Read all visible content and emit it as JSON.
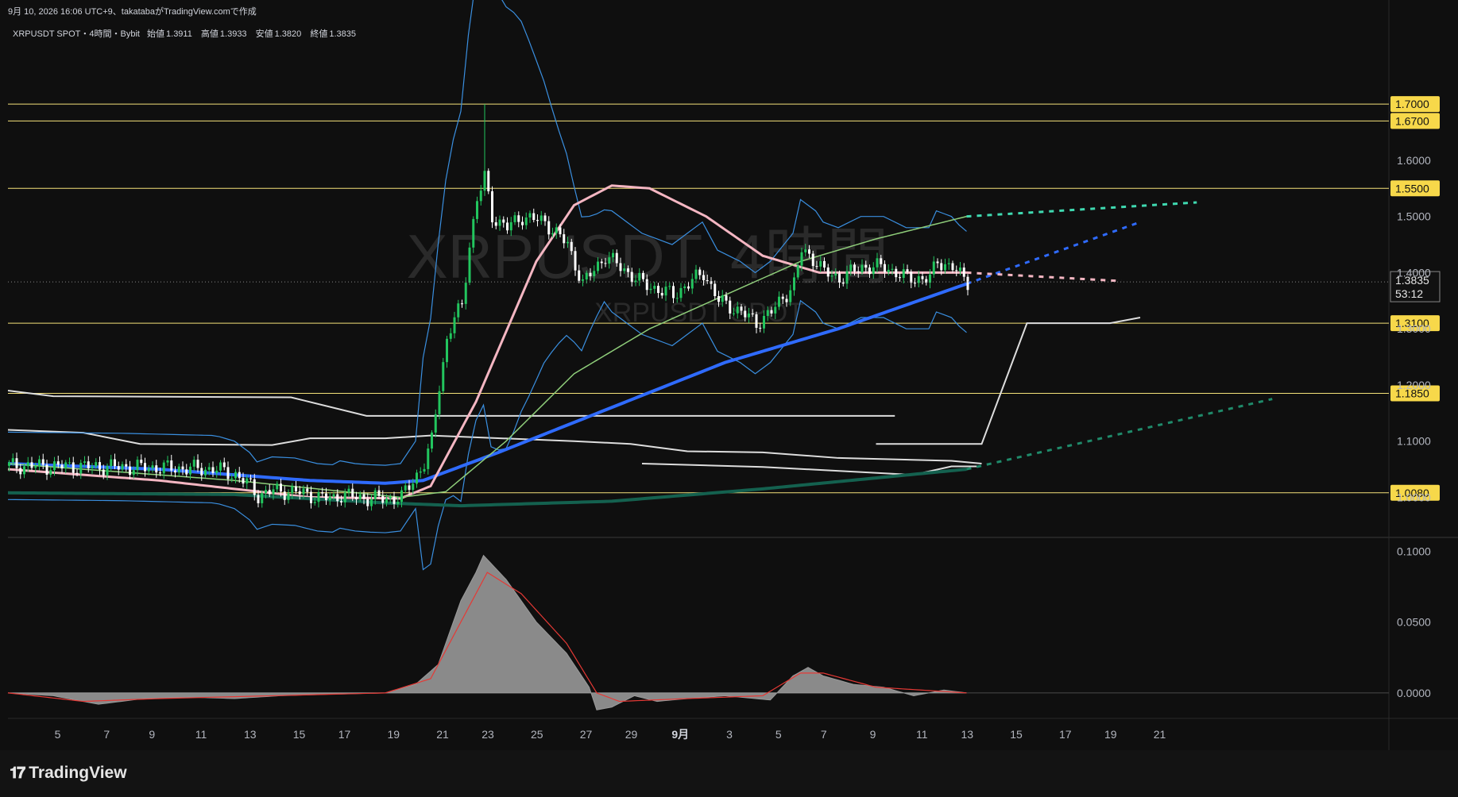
{
  "header": {
    "caption": "9月 10, 2026 16:06 UTC+9、takatabaがTradingView.comで作成"
  },
  "symbol": {
    "title": "XRPUSDT SPOT・4時間・Bybit",
    "open_label": "始値",
    "open": "1.3911",
    "high_label": "高値",
    "high": "1.3933",
    "low_label": "安値",
    "low": "1.3820",
    "close_label": "終値",
    "close": "1.3835"
  },
  "watermark": {
    "line1": "XRPUSDT, 4時間",
    "line2": "XRPUSDT SPOT"
  },
  "footer": {
    "brand": "TradingView"
  },
  "colors": {
    "background": "#0f0f0f",
    "grid": "#1f1f1f",
    "up": "#22c55e",
    "down": "#ffffff",
    "ma_blue": "#2f6bff",
    "ma_pink": "#f4b6c2",
    "ma_teal": "#14614f",
    "ma_green": "#8fce7a",
    "bollinger": "#3a8fe0",
    "level": "#f5e27a",
    "hist": "#8a8a8a",
    "signal": "#e53935"
  },
  "chart_data": [
    {
      "type": "candlestick",
      "title": "XRPUSDT SPOT 4時間 Bybit",
      "x_tick_labels": [
        "5",
        "7",
        "9",
        "11",
        "13",
        "15",
        "17",
        "19",
        "21",
        "23",
        "25",
        "27",
        "29",
        "9月",
        "3",
        "5",
        "7",
        "9",
        "11",
        "13",
        "15",
        "17",
        "19",
        "21"
      ],
      "y_tick_labels": [
        "1.6000",
        "1.5000",
        "1.4000",
        "1.3000",
        "1.2000",
        "1.1000",
        "1.0000"
      ],
      "ylim": [
        0.93,
        1.85
      ],
      "current_price": "1.3835",
      "countdown": "53:12",
      "horizontal_levels": [
        {
          "value": 1.7,
          "label": "1.7000"
        },
        {
          "value": 1.67,
          "label": "1.6700"
        },
        {
          "value": 1.55,
          "label": "1.5500"
        },
        {
          "value": 1.31,
          "label": "1.3100"
        },
        {
          "value": 1.185,
          "label": "1.1850"
        },
        {
          "value": 1.008,
          "label": "1.0080"
        }
      ],
      "price_path": [
        [
          0,
          1.056
        ],
        [
          30,
          1.054
        ],
        [
          55,
          1.05
        ],
        [
          60,
          1.04
        ],
        [
          64,
          1.02
        ],
        [
          66,
          1.003
        ],
        [
          70,
          1.012
        ],
        [
          76,
          1.01
        ],
        [
          82,
          1.0
        ],
        [
          86,
          0.998
        ],
        [
          88,
          1.005
        ],
        [
          92,
          1.0
        ],
        [
          96,
          0.998
        ],
        [
          100,
          0.997
        ],
        [
          104,
          1.0
        ],
        [
          110,
          1.06
        ],
        [
          112,
          1.1
        ],
        [
          114,
          1.2
        ],
        [
          116,
          1.28
        ],
        [
          118,
          1.32
        ],
        [
          120,
          1.34
        ],
        [
          122,
          1.45
        ],
        [
          124,
          1.53
        ],
        [
          126,
          1.57
        ],
        [
          128,
          1.5
        ],
        [
          132,
          1.48
        ],
        [
          136,
          1.5
        ],
        [
          142,
          1.49
        ],
        [
          148,
          1.45
        ],
        [
          152,
          1.38
        ],
        [
          158,
          1.43
        ],
        [
          162,
          1.41
        ],
        [
          168,
          1.38
        ],
        [
          172,
          1.37
        ],
        [
          176,
          1.36
        ],
        [
          180,
          1.38
        ],
        [
          184,
          1.4
        ],
        [
          188,
          1.35
        ],
        [
          194,
          1.33
        ],
        [
          198,
          1.31
        ],
        [
          202,
          1.33
        ],
        [
          208,
          1.38
        ],
        [
          210,
          1.44
        ],
        [
          214,
          1.42
        ],
        [
          216,
          1.4
        ],
        [
          220,
          1.39
        ],
        [
          226,
          1.41
        ],
        [
          232,
          1.41
        ],
        [
          238,
          1.39
        ],
        [
          244,
          1.39
        ],
        [
          246,
          1.42
        ],
        [
          250,
          1.41
        ],
        [
          252,
          1.395
        ],
        [
          254,
          1.3835
        ]
      ],
      "series": [
        {
          "name": "",
          "color": "#2f6bff",
          "points": [
            [
              0,
              1.06
            ],
            [
              40,
              1.05
            ],
            [
              80,
              1.03
            ],
            [
              100,
              1.025
            ],
            [
              110,
              1.03
            ],
            [
              130,
              1.08
            ],
            [
              160,
              1.16
            ],
            [
              190,
              1.24
            ],
            [
              220,
              1.3
            ],
            [
              254,
              1.38
            ]
          ],
          "projection": [
            [
              254,
              1.38
            ],
            [
              300,
              1.49
            ]
          ]
        },
        {
          "name": "",
          "color": "#f4b6c2",
          "points": [
            [
              0,
              1.05
            ],
            [
              40,
              1.03
            ],
            [
              80,
              1.0
            ],
            [
              104,
              0.998
            ],
            [
              112,
              1.02
            ],
            [
              124,
              1.17
            ],
            [
              140,
              1.42
            ],
            [
              150,
              1.52
            ],
            [
              160,
              1.555
            ],
            [
              170,
              1.55
            ],
            [
              185,
              1.5
            ],
            [
              200,
              1.43
            ],
            [
              215,
              1.4
            ],
            [
              235,
              1.4
            ],
            [
              254,
              1.4
            ]
          ],
          "projection": [
            [
              254,
              1.4
            ],
            [
              295,
              1.385
            ]
          ]
        },
        {
          "name": "",
          "color": "#14614f",
          "points": [
            [
              0,
              1.008
            ],
            [
              60,
              1.005
            ],
            [
              100,
              0.99
            ],
            [
              120,
              0.985
            ],
            [
              160,
              0.993
            ],
            [
              200,
              1.015
            ],
            [
              254,
              1.05
            ]
          ],
          "projection": [
            [
              254,
              1.05
            ],
            [
              335,
              1.175
            ]
          ]
        },
        {
          "name": "",
          "color": "#8fce7a",
          "points": [
            [
              0,
              1.06
            ],
            [
              60,
              1.03
            ],
            [
              104,
              1.0
            ],
            [
              116,
              1.01
            ],
            [
              132,
              1.1
            ],
            [
              150,
              1.22
            ],
            [
              170,
              1.3
            ],
            [
              190,
              1.36
            ],
            [
              210,
              1.42
            ],
            [
              230,
              1.46
            ],
            [
              254,
              1.5
            ]
          ],
          "projection": [
            [
              254,
              1.5
            ],
            [
              315,
              1.525
            ]
          ]
        }
      ],
      "oscillator": {
        "y_tick_labels": [
          "0.1000",
          "0.0500",
          "0.0000"
        ],
        "ylim": [
          -0.018,
          0.108
        ],
        "histogram": [
          [
            0,
            0.0
          ],
          [
            12,
            -0.002
          ],
          [
            24,
            -0.008
          ],
          [
            36,
            -0.004
          ],
          [
            48,
            -0.003
          ],
          [
            60,
            -0.004
          ],
          [
            72,
            -0.002
          ],
          [
            84,
            -0.001
          ],
          [
            100,
            0.0
          ],
          [
            108,
            0.006
          ],
          [
            114,
            0.02
          ],
          [
            120,
            0.065
          ],
          [
            124,
            0.085
          ],
          [
            126,
            0.097
          ],
          [
            132,
            0.08
          ],
          [
            140,
            0.05
          ],
          [
            148,
            0.028
          ],
          [
            154,
            0.004
          ],
          [
            156,
            -0.012
          ],
          [
            160,
            -0.01
          ],
          [
            166,
            -0.002
          ],
          [
            172,
            -0.006
          ],
          [
            180,
            -0.004
          ],
          [
            190,
            -0.002
          ],
          [
            202,
            -0.005
          ],
          [
            208,
            0.012
          ],
          [
            212,
            0.018
          ],
          [
            216,
            0.012
          ],
          [
            224,
            0.006
          ],
          [
            232,
            0.004
          ],
          [
            240,
            -0.002
          ],
          [
            248,
            0.002
          ],
          [
            254,
            0.0
          ]
        ],
        "signal": [
          [
            0,
            0.0
          ],
          [
            20,
            -0.006
          ],
          [
            40,
            -0.004
          ],
          [
            70,
            -0.002
          ],
          [
            100,
            0.0
          ],
          [
            112,
            0.01
          ],
          [
            120,
            0.05
          ],
          [
            127,
            0.085
          ],
          [
            136,
            0.07
          ],
          [
            148,
            0.035
          ],
          [
            156,
            0.0
          ],
          [
            162,
            -0.006
          ],
          [
            180,
            -0.004
          ],
          [
            200,
            -0.002
          ],
          [
            210,
            0.014
          ],
          [
            216,
            0.014
          ],
          [
            230,
            0.004
          ],
          [
            254,
            0.0
          ]
        ]
      }
    }
  ]
}
